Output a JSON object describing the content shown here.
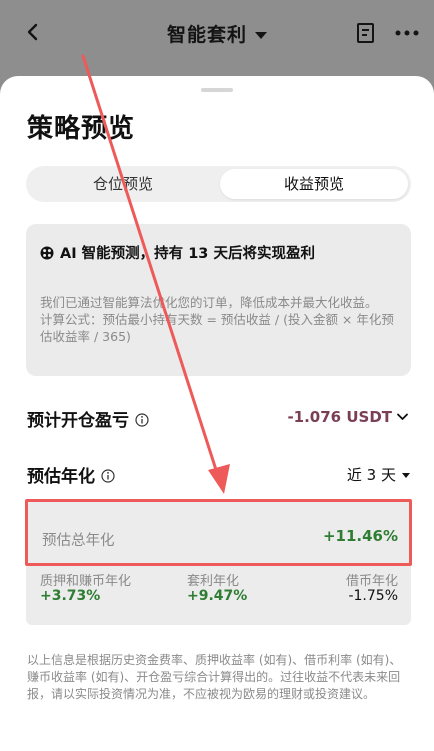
{
  "header": {
    "title": "智能套利",
    "back_icon": "chevron-left-icon",
    "doc_icon": "document-icon",
    "more_icon": "more-dots-icon"
  },
  "sheet": {
    "title": "策略预览",
    "tabs": [
      {
        "label": "仓位预览",
        "selected": false
      },
      {
        "label": "收益预览",
        "selected": true
      }
    ],
    "ai_card": {
      "headline": "AI 智能预测，持有 13 天后将实现盈利",
      "body_line1": "我们已通过智能算法优化您的订单，降低成本并最大化收益。",
      "body_line2": "计算公式：预估最小持有天数 = 预估收益 / (投入金额 × 年化预估收益率 / 365)"
    },
    "pnl": {
      "label": "预计开仓盈亏",
      "value": "-1.076 USDT"
    },
    "apr": {
      "label": "预估年化",
      "period": "近 3 天",
      "total_label": "预估总年化",
      "total_value": "+11.46%",
      "items": [
        {
          "label": "质押和赚币年化",
          "value": "+3.73%"
        },
        {
          "label": "套利年化",
          "value": "+9.47%"
        },
        {
          "label": "借币年化",
          "value": "-1.75%"
        }
      ]
    },
    "disclaimer": "以上信息是根据历史资金费率、质押收益率 (如有)、借币利率 (如有)、赚币收益率 (如有)、开仓盈亏综合计算得出的。过往收益不代表未来回报，请以实际投资情况为准，不应被视为欧易的理财或投资建议。"
  },
  "colors": {
    "positive": "#2e7d32",
    "pnl_negative": "#7a3f55",
    "annotation": "#ee5a5a"
  }
}
